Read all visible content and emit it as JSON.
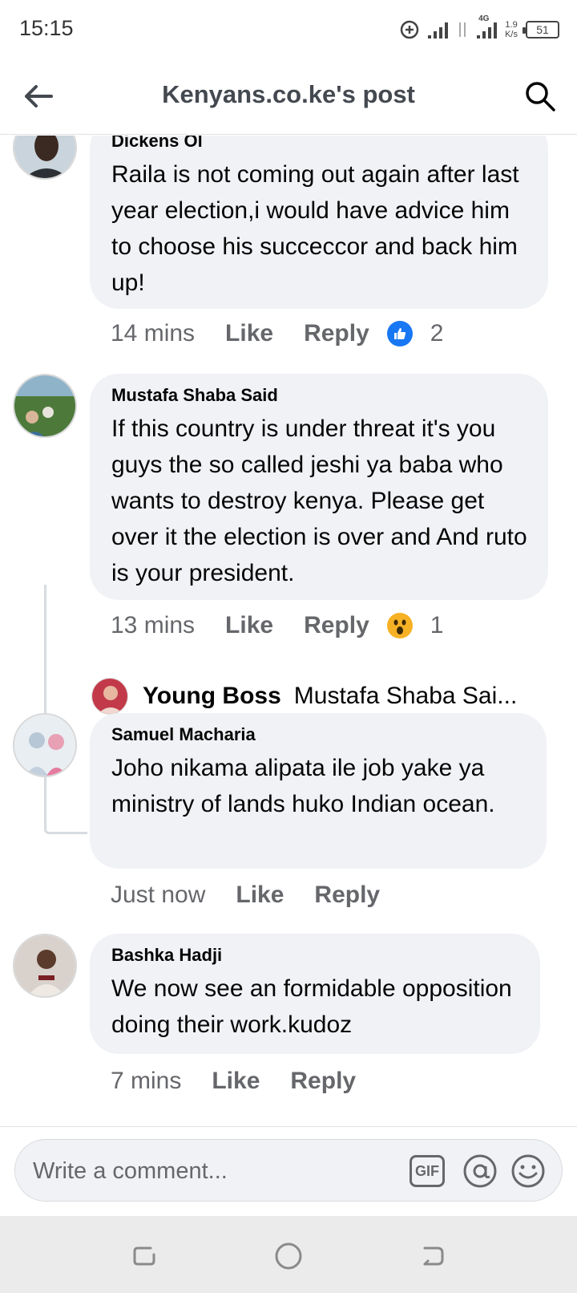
{
  "status_bar": {
    "time": "15:15",
    "network_type": "4G",
    "rate_value": "1.9",
    "rate_unit": "K/s",
    "battery": "51"
  },
  "header": {
    "title": "Kenyans.co.ke's post",
    "back_icon": "back-arrow-icon",
    "search_icon": "search-icon"
  },
  "comments": [
    {
      "author": "Dickens Ol",
      "text": "Raila is not coming out again after last year election,i would have advice him to choose his succeccor and back him up!",
      "time": "14 mins",
      "like_label": "Like",
      "reply_label": "Reply",
      "reaction_icon": "like-reaction-icon",
      "reaction_count": "2"
    },
    {
      "author": "Mustafa Shaba Said",
      "text": "If this country is under threat it's you guys the so called jeshi ya baba who wants to destroy kenya. Please get over it the election is over and And ruto is your president.",
      "time": "13 mins",
      "like_label": "Like",
      "reply_label": "Reply",
      "reaction_icon": "wow-reaction-icon",
      "reaction_count": "1",
      "reply_preview": {
        "author": "Young Boss",
        "text": "Mustafa Shaba Sai..."
      }
    },
    {
      "author": "Samuel Macharia",
      "text": "Joho nikama alipata ile job yake ya ministry of lands huko Indian ocean.",
      "time": "Just now",
      "like_label": "Like",
      "reply_label": "Reply"
    },
    {
      "author": "Bashka Hadji",
      "text": "We now see an formidable opposition doing their work.kudoz",
      "time": "7 mins",
      "like_label": "Like",
      "reply_label": "Reply"
    }
  ],
  "composer": {
    "placeholder": "Write a comment...",
    "gif_label": "GIF",
    "mention_icon": "mention-icon",
    "emoji_icon": "emoji-icon"
  },
  "colors": {
    "bubble": "#f0f2f5",
    "meta_text": "#65676b",
    "like_blue": "#1877f2",
    "wow_yellow": "#f7b125"
  }
}
